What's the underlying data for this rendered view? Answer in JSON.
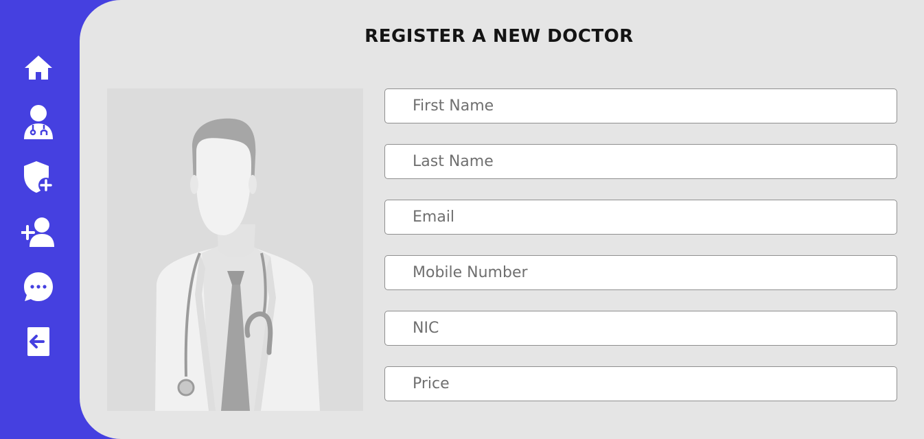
{
  "sidebar": {
    "items": [
      {
        "name": "home",
        "icon": "home-icon"
      },
      {
        "name": "doctor",
        "icon": "doctor-icon"
      },
      {
        "name": "insurance",
        "icon": "shield-plus-icon"
      },
      {
        "name": "add-user",
        "icon": "user-plus-icon"
      },
      {
        "name": "messages",
        "icon": "chat-bubble-icon"
      },
      {
        "name": "logout",
        "icon": "logout-icon"
      }
    ]
  },
  "page": {
    "title": "REGISTER A NEW DOCTOR"
  },
  "form": {
    "first_name": {
      "placeholder": "First Name",
      "value": ""
    },
    "last_name": {
      "placeholder": "Last Name",
      "value": ""
    },
    "email": {
      "placeholder": "Email",
      "value": ""
    },
    "mobile": {
      "placeholder": "Mobile Number",
      "value": ""
    },
    "nic": {
      "placeholder": "NIC",
      "value": ""
    },
    "price": {
      "placeholder": "Price",
      "value": ""
    }
  },
  "theme": {
    "sidebar_color": "#4540e0",
    "main_bg": "#e5e5e5",
    "icon_color": "#ffffff"
  }
}
